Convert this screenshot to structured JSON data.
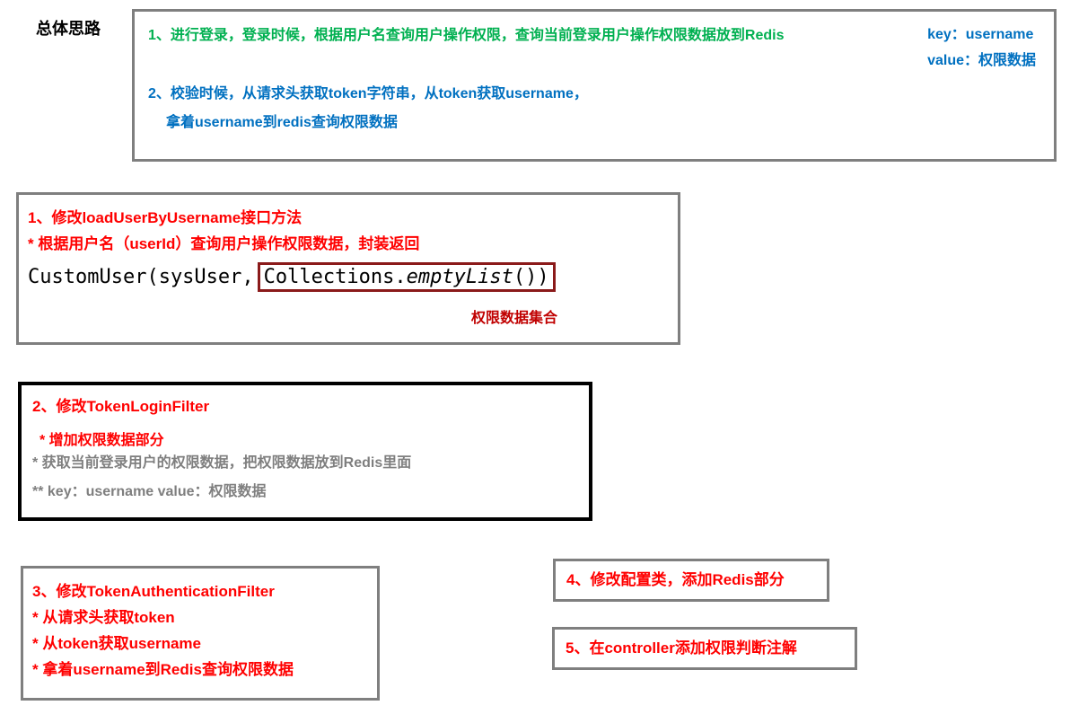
{
  "title": "总体思路",
  "topBox": {
    "line1": "1、进行登录，登录时候，根据用户名查询用户操作权限，查询当前登录用户操作权限数据放到Redis",
    "rightKey": "key：username",
    "rightValue": "value：权限数据",
    "line2": "2、校验时候，从请求头获取token字符串，从token获取username，",
    "line3": "拿着username到redis查询权限数据"
  },
  "box1": {
    "title": "1、修改loadUserByUsername接口方法",
    "sub": "* 根据用户名（userId）查询用户操作权限数据，封装返回",
    "codeLeft": "CustomUser(sysUser,",
    "codeRight1": "Collections.",
    "codeRight2": "emptyList",
    "codeRight3": "())",
    "label": "权限数据集合"
  },
  "box2": {
    "title": "2、修改TokenLoginFilter",
    "sub1": "* 增加权限数据部分",
    "gray1": "* 获取当前登录用户的权限数据，把权限数据放到Redis里面",
    "gray2": "** key：username   value：权限数据"
  },
  "box3": {
    "title": "3、修改TokenAuthenticationFilter",
    "line1": "* 从请求头获取token",
    "line2": "* 从token获取username",
    "line3": "* 拿着username到Redis查询权限数据"
  },
  "box4": {
    "text": "4、修改配置类，添加Redis部分"
  },
  "box5": {
    "text": "5、在controller添加权限判断注解"
  }
}
